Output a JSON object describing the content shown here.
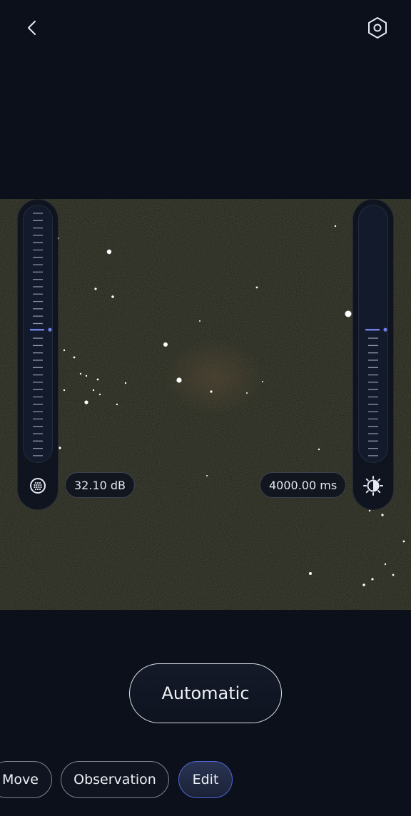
{
  "header": {
    "back_icon": "chevron-left-icon",
    "settings_icon": "hexagon-settings-icon"
  },
  "sky_view": {
    "background_color": "#24261d"
  },
  "gain_control": {
    "icon": "gain-grid-icon",
    "value_text": "32.10 dB",
    "level_fraction": 0.52,
    "accent_color": "#6f7fe6"
  },
  "exposure_control": {
    "icon": "brightness-contrast-icon",
    "value_text": "4000.00 ms",
    "level_fraction": 0.52,
    "accent_color": "#6f7fe6"
  },
  "mode_button": {
    "label": "Automatic"
  },
  "bottom_tabs": {
    "items": [
      {
        "label": "Move",
        "active": false
      },
      {
        "label": "Observation",
        "active": false
      },
      {
        "label": "Edit",
        "active": true
      }
    ],
    "active_color": "#4e66d8"
  }
}
